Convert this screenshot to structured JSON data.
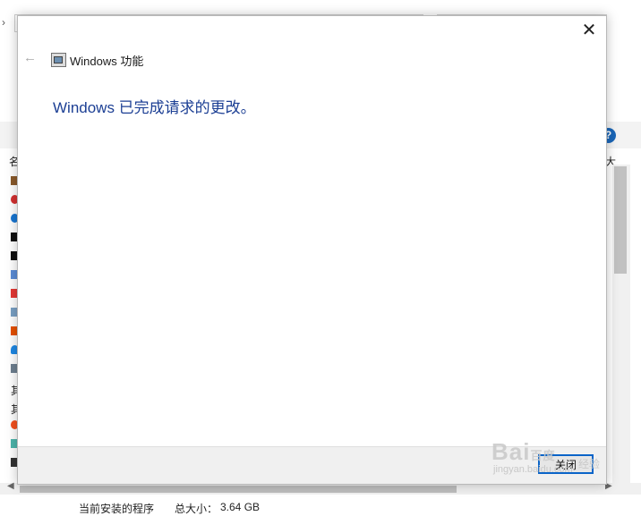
{
  "background": {
    "column_label_left": "名",
    "column_label_right": "大",
    "help_icon": "?",
    "list_row_label_1": "其",
    "list_row_label_2": "其",
    "status": {
      "label": "当前安装的程序",
      "size_label": "总大小：",
      "size_value": "3.64 GB"
    },
    "icon_colors": [
      "#8a5a2b",
      "#d32f2f",
      "#1976d2",
      "#111111",
      "#111111",
      "#5c8dd6",
      "#e53935",
      "#7aa0c4",
      "#e65100",
      "#1e88e5",
      "#6e7f90",
      "#f4511e",
      "#4db6ac",
      "#333333"
    ]
  },
  "dialog": {
    "title": "Windows 功能",
    "message": "Windows 已完成请求的更改。",
    "close_icon": "✕",
    "back_icon": "←",
    "close_button_label": "关闭"
  },
  "watermark": {
    "logo": "Bai",
    "logo_tail": "百度",
    "sub": "jingyan.baidu.com",
    "inline_label": "经验"
  }
}
